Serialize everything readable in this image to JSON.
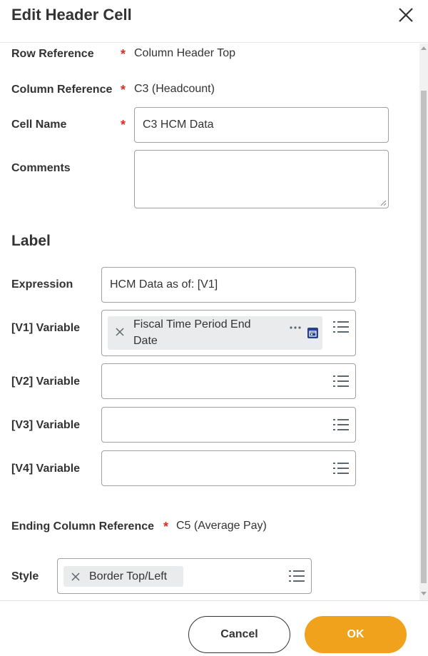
{
  "dialog": {
    "title": "Edit Header Cell"
  },
  "fields": {
    "row_reference": {
      "label": "Row Reference",
      "value": "Column Header Top"
    },
    "column_reference": {
      "label": "Column Reference",
      "value": "C3 (Headcount)"
    },
    "cell_name": {
      "label": "Cell Name",
      "value": "C3 HCM Data"
    },
    "comments": {
      "label": "Comments",
      "value": ""
    }
  },
  "label_section": {
    "title": "Label",
    "expression": {
      "label": "Expression",
      "value": "HCM Data as of: [V1]"
    },
    "v1": {
      "label": "[V1] Variable",
      "chip_line1": "Fiscal Time Period End",
      "chip_line2": "Date"
    },
    "v2": {
      "label": "[V2] Variable"
    },
    "v3": {
      "label": "[V3] Variable"
    },
    "v4": {
      "label": "[V4] Variable"
    }
  },
  "ending_column_reference": {
    "label": "Ending Column Reference",
    "value": "C5 (Average Pay)"
  },
  "style": {
    "label": "Style",
    "chip": "Border Top/Left"
  },
  "buttons": {
    "cancel": "Cancel",
    "ok": "OK"
  },
  "colors": {
    "accent": "#f0a21d",
    "required": "#de2e21",
    "calendar_icon": "#27408b"
  },
  "icons": {
    "close": "close-icon",
    "list": "list-icon",
    "calendar": "calendar-icon",
    "more": "ellipsis-icon",
    "remove": "remove-x-icon"
  }
}
